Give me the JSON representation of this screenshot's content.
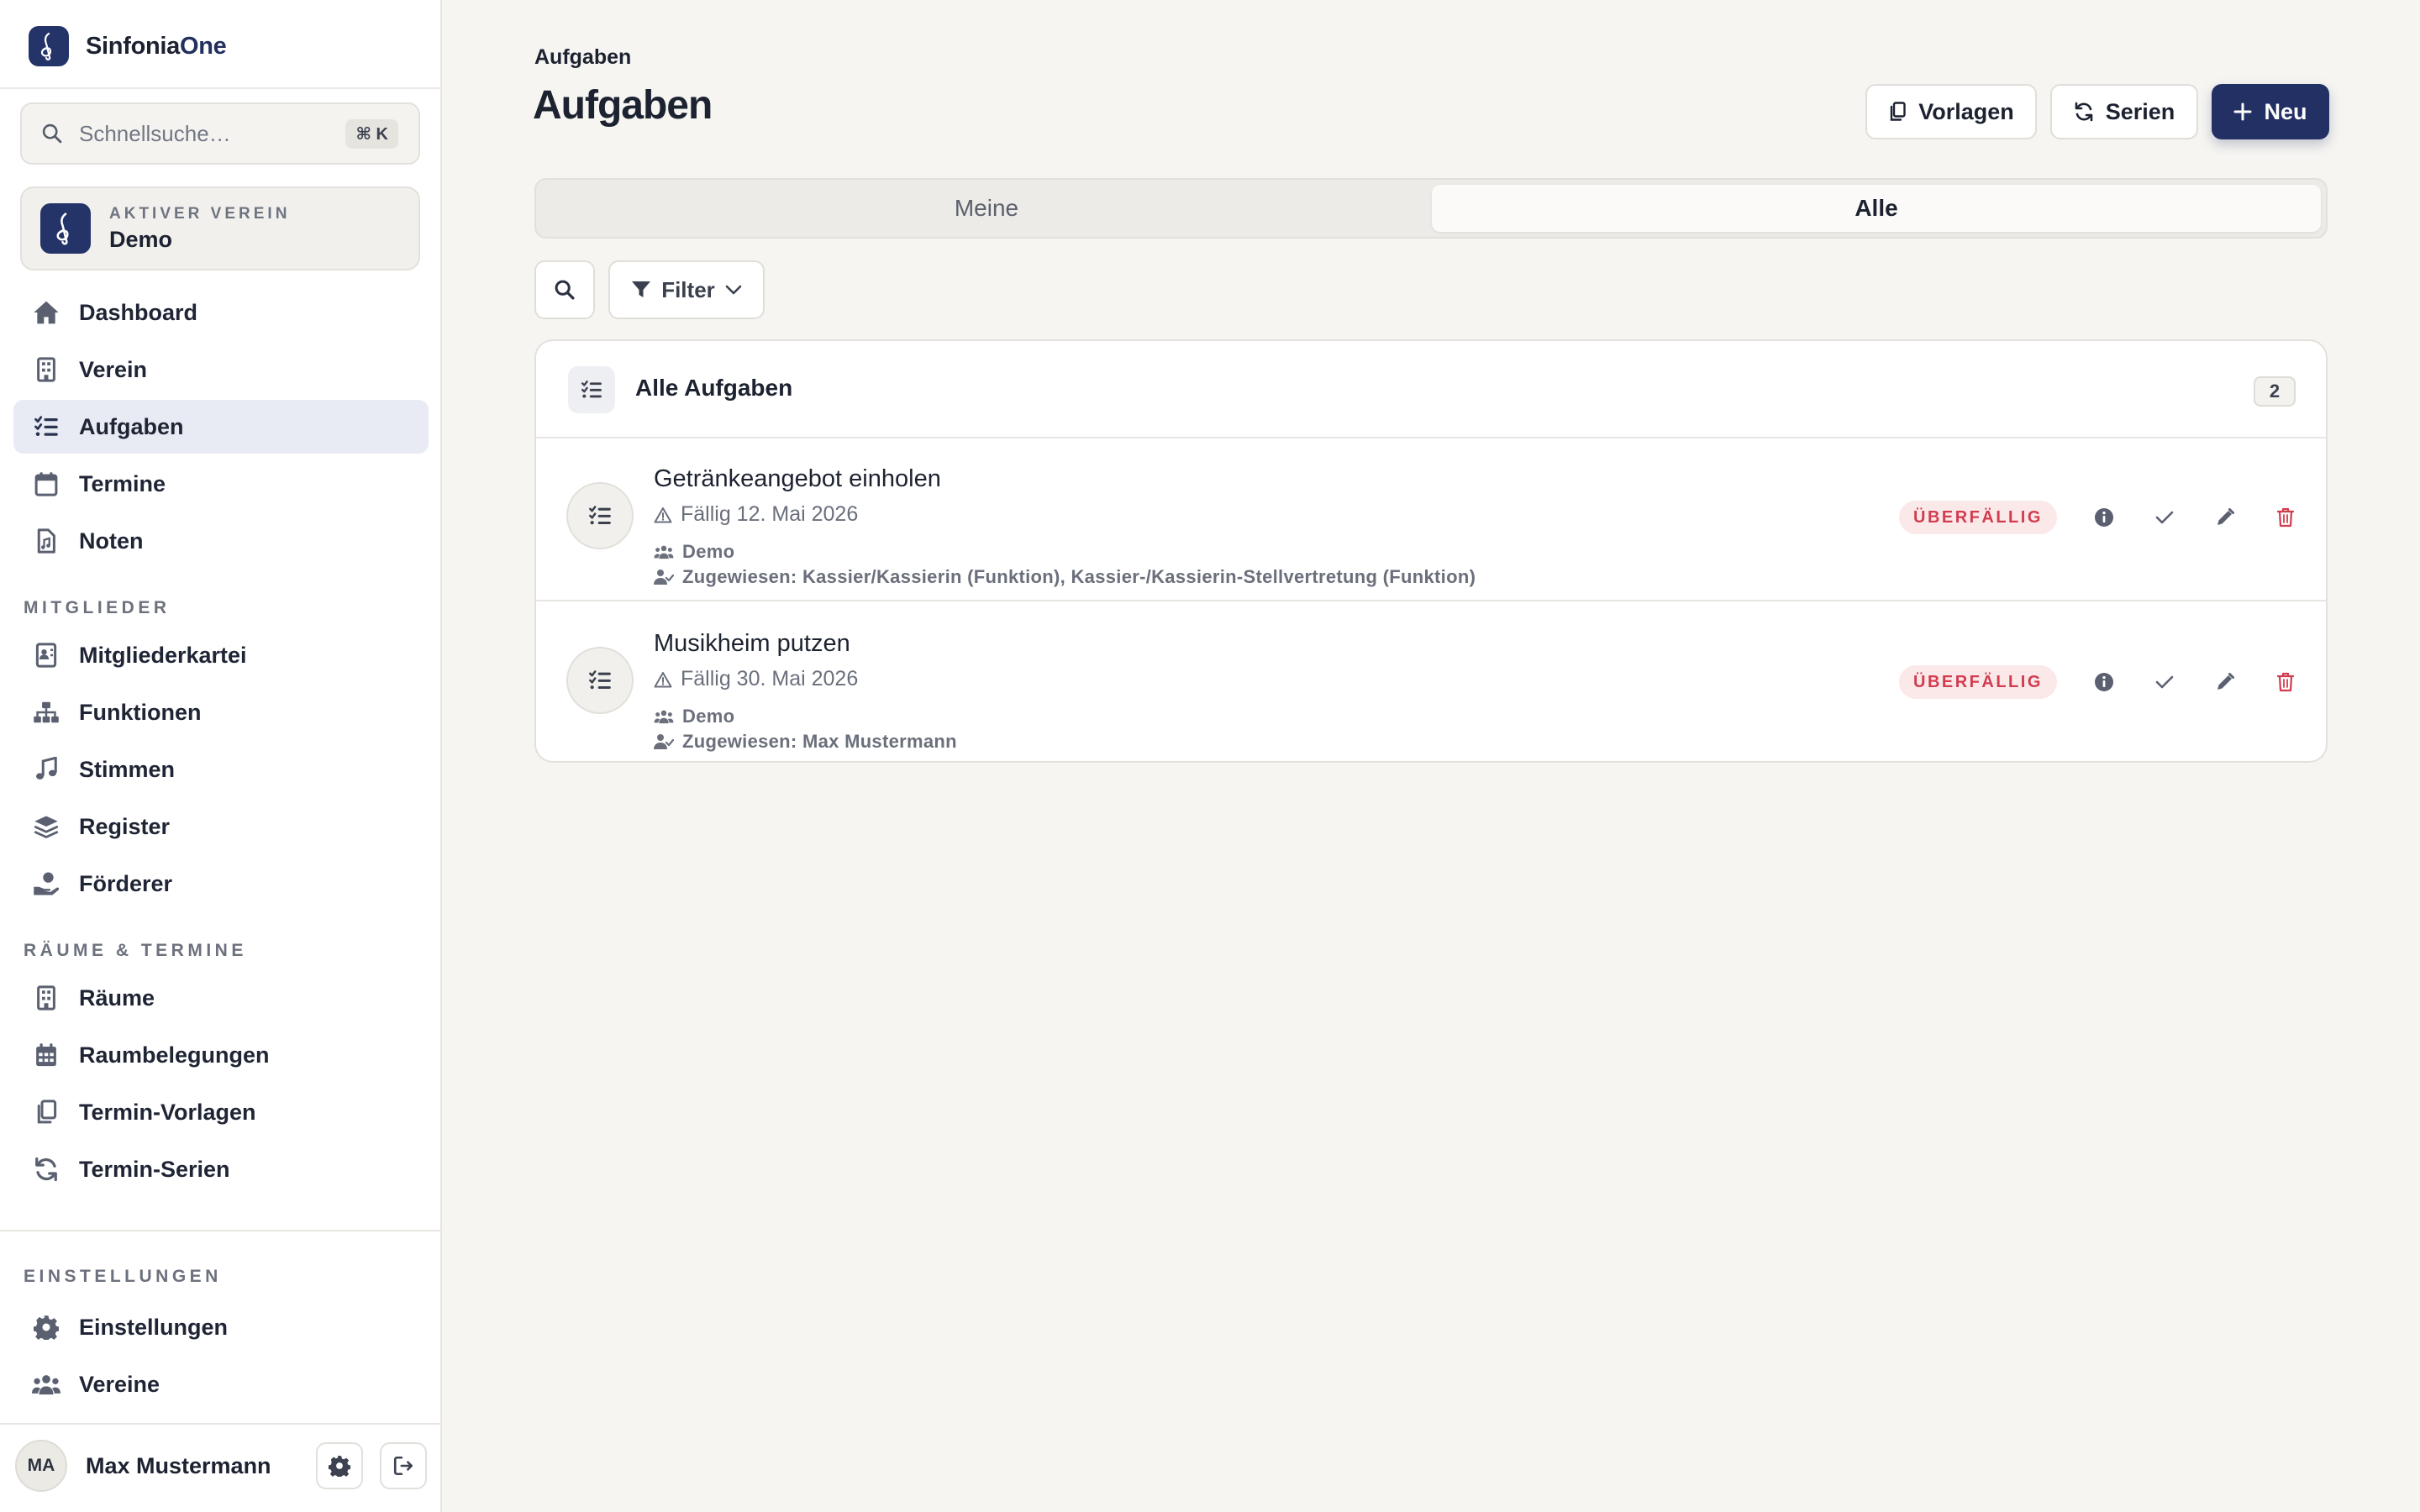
{
  "app": {
    "brand_prefix": "Sinfonia",
    "brand_suffix": "One"
  },
  "sidebar": {
    "search": {
      "placeholder": "Schnellsuche…",
      "shortcut": "⌘ K"
    },
    "active_club": {
      "kicker": "AKTIVER VEREIN",
      "name": "Demo"
    },
    "main_nav": [
      {
        "label": "Dashboard",
        "icon": "home-icon",
        "active": false
      },
      {
        "label": "Verein",
        "icon": "building-icon",
        "active": false
      },
      {
        "label": "Aufgaben",
        "icon": "list-check-icon",
        "active": true
      },
      {
        "label": "Termine",
        "icon": "calendar-icon",
        "active": false
      },
      {
        "label": "Noten",
        "icon": "sheet-music-icon",
        "active": false
      }
    ],
    "sections": [
      {
        "title": "MITGLIEDER",
        "items": [
          {
            "label": "Mitgliederkartei",
            "icon": "id-card-icon"
          },
          {
            "label": "Funktionen",
            "icon": "sitemap-icon"
          },
          {
            "label": "Stimmen",
            "icon": "music-note-icon"
          },
          {
            "label": "Register",
            "icon": "layers-icon"
          },
          {
            "label": "Förderer",
            "icon": "hand-heart-icon"
          }
        ]
      },
      {
        "title": "RÄUME & TERMINE",
        "items": [
          {
            "label": "Räume",
            "icon": "building-icon"
          },
          {
            "label": "Raumbelegungen",
            "icon": "calendar-grid-icon"
          },
          {
            "label": "Termin-Vorlagen",
            "icon": "copy-icon"
          },
          {
            "label": "Termin-Serien",
            "icon": "refresh-icon"
          }
        ]
      },
      {
        "title": "EINSTELLUNGEN",
        "items": [
          {
            "label": "Einstellungen",
            "icon": "gear-icon"
          },
          {
            "label": "Vereine",
            "icon": "users-icon"
          }
        ]
      }
    ],
    "user": {
      "initials": "MA",
      "name": "Max Mustermann"
    }
  },
  "main": {
    "breadcrumb": "Aufgaben",
    "title": "Aufgaben",
    "actions": {
      "templates": "Vorlagen",
      "series": "Serien",
      "new": "Neu"
    },
    "tabs": [
      {
        "label": "Meine",
        "selected": false
      },
      {
        "label": "Alle",
        "selected": true
      }
    ],
    "filter_label": "Filter",
    "list": {
      "title": "Alle Aufgaben",
      "count": "2",
      "tasks": [
        {
          "title": "Getränkeangebot einholen",
          "due": "Fällig 12. Mai 2026",
          "club": "Demo",
          "assigned": "Zugewiesen: Kassier/Kassierin (Funktion), Kassier-/Kassierin-Stellvertretung (Funktion)",
          "status": "ÜBERFÄLLIG"
        },
        {
          "title": "Musikheim putzen",
          "due": "Fällig 30. Mai 2026",
          "club": "Demo",
          "assigned": "Zugewiesen: Max Mustermann",
          "status": "ÜBERFÄLLIG"
        }
      ]
    }
  },
  "colors": {
    "brand": "#233064",
    "overdue_text": "#d23c4f",
    "overdue_bg": "#fbe9ea",
    "delete": "#d23c4f",
    "background": "#f6f5f2"
  }
}
